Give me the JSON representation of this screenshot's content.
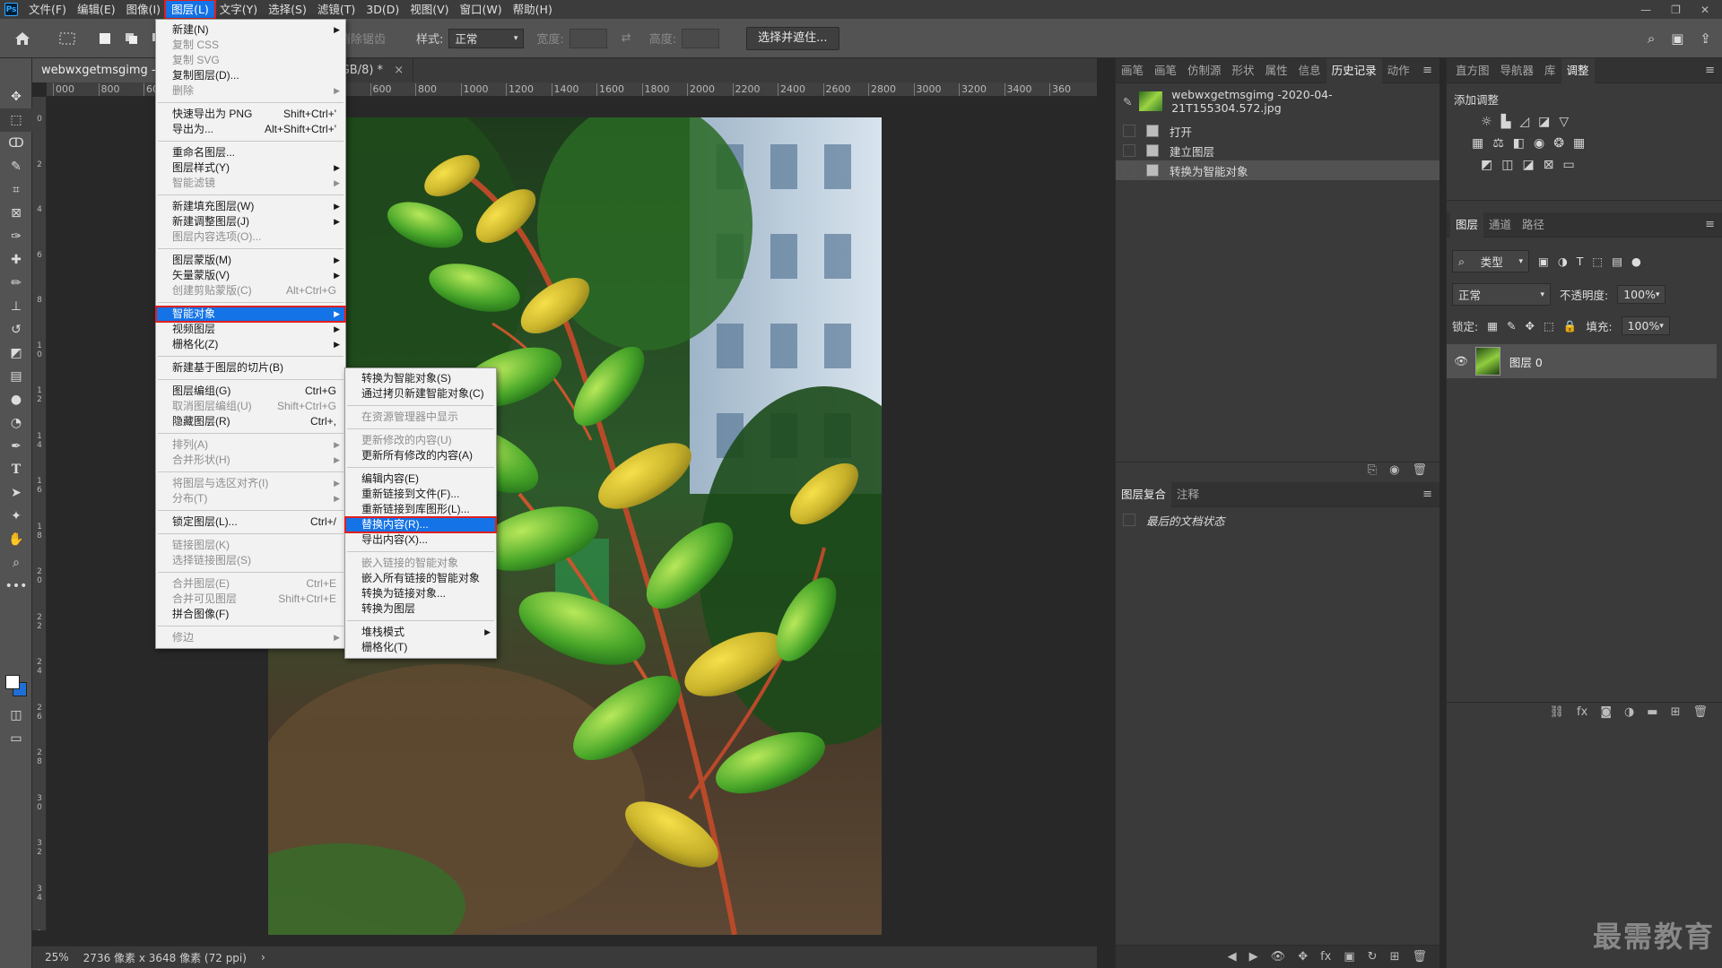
{
  "app": {
    "logo": "Ps"
  },
  "menubar": {
    "items": [
      "文件(F)",
      "编辑(E)",
      "图像(I)",
      "图层(L)",
      "文字(Y)",
      "选择(S)",
      "滤镜(T)",
      "3D(D)",
      "视图(V)",
      "窗口(W)",
      "帮助(H)"
    ],
    "active_index": 3
  },
  "options": {
    "style_label": "样式:",
    "style_value": "正常",
    "width_label": "宽度:",
    "height_label": "高度:",
    "feather_label": "消除锯齿",
    "select_mask_button": "选择并遮住..."
  },
  "document": {
    "tabs": [
      "webwxgetmsgimg - 2",
      "层 0, RGB/8) *"
    ],
    "ruler_top": [
      "000",
      "800",
      "600",
      "",
      "",
      "",
      "400",
      "600",
      "800",
      "1000",
      "1200",
      "1400",
      "1600",
      "1800",
      "2000",
      "2200",
      "2400",
      "2600",
      "2800",
      "3000",
      "3200",
      "3400",
      "360"
    ],
    "ruler_left": [
      "0",
      "2",
      "4",
      "6",
      "8",
      "1\n0",
      "1\n2",
      "1\n4",
      "1\n6",
      "1\n8",
      "2\n0",
      "2\n2",
      "2\n4",
      "2\n6",
      "2\n8",
      "3\n0",
      "3\n2",
      "3\n4",
      "3\n6"
    ],
    "zoom": "25%",
    "dimensions": "2736 像素 x 3648 像素 (72 ppi)"
  },
  "layer_menu": {
    "items": [
      {
        "label": "新建(N)",
        "arrow": true
      },
      {
        "label": "复制 CSS",
        "disabled": true
      },
      {
        "label": "复制 SVG",
        "disabled": true
      },
      {
        "label": "复制图层(D)..."
      },
      {
        "label": "删除",
        "disabled": true,
        "arrow": true
      },
      {
        "sep": true
      },
      {
        "label": "快速导出为 PNG",
        "shortcut": "Shift+Ctrl+'"
      },
      {
        "label": "导出为...",
        "shortcut": "Alt+Shift+Ctrl+'"
      },
      {
        "sep": true
      },
      {
        "label": "重命名图层..."
      },
      {
        "label": "图层样式(Y)",
        "arrow": true
      },
      {
        "label": "智能滤镜",
        "disabled": true,
        "arrow": true
      },
      {
        "sep": true
      },
      {
        "label": "新建填充图层(W)",
        "arrow": true
      },
      {
        "label": "新建调整图层(J)",
        "arrow": true
      },
      {
        "label": "图层内容选项(O)...",
        "disabled": true
      },
      {
        "sep": true
      },
      {
        "label": "图层蒙版(M)",
        "arrow": true
      },
      {
        "label": "矢量蒙版(V)",
        "arrow": true
      },
      {
        "label": "创建剪贴蒙版(C)",
        "shortcut": "Alt+Ctrl+G",
        "disabled": true
      },
      {
        "sep": true
      },
      {
        "label": "智能对象",
        "arrow": true,
        "highlight": true
      },
      {
        "label": "视频图层",
        "arrow": true
      },
      {
        "label": "栅格化(Z)",
        "arrow": true
      },
      {
        "sep": true
      },
      {
        "label": "新建基于图层的切片(B)"
      },
      {
        "sep": true
      },
      {
        "label": "图层编组(G)",
        "shortcut": "Ctrl+G"
      },
      {
        "label": "取消图层编组(U)",
        "shortcut": "Shift+Ctrl+G",
        "disabled": true
      },
      {
        "label": "隐藏图层(R)",
        "shortcut": "Ctrl+,"
      },
      {
        "sep": true
      },
      {
        "label": "排列(A)",
        "disabled": true,
        "arrow": true
      },
      {
        "label": "合并形状(H)",
        "disabled": true,
        "arrow": true
      },
      {
        "sep": true
      },
      {
        "label": "将图层与选区对齐(I)",
        "disabled": true,
        "arrow": true
      },
      {
        "label": "分布(T)",
        "disabled": true,
        "arrow": true
      },
      {
        "sep": true
      },
      {
        "label": "锁定图层(L)...",
        "shortcut": "Ctrl+/"
      },
      {
        "sep": true
      },
      {
        "label": "链接图层(K)",
        "disabled": true
      },
      {
        "label": "选择链接图层(S)",
        "disabled": true
      },
      {
        "sep": true
      },
      {
        "label": "合并图层(E)",
        "shortcut": "Ctrl+E",
        "disabled": true
      },
      {
        "label": "合并可见图层",
        "shortcut": "Shift+Ctrl+E",
        "disabled": true
      },
      {
        "label": "拼合图像(F)"
      },
      {
        "sep": true
      },
      {
        "label": "修边",
        "disabled": true,
        "arrow": true
      }
    ]
  },
  "smart_object_menu": {
    "items": [
      {
        "label": "转换为智能对象(S)"
      },
      {
        "label": "通过拷贝新建智能对象(C)"
      },
      {
        "sep": true
      },
      {
        "label": "在资源管理器中显示",
        "disabled": true
      },
      {
        "sep": true
      },
      {
        "label": "更新修改的内容(U)",
        "disabled": true
      },
      {
        "label": "更新所有修改的内容(A)"
      },
      {
        "sep": true
      },
      {
        "label": "编辑内容(E)"
      },
      {
        "label": "重新链接到文件(F)..."
      },
      {
        "label": "重新链接到库图形(L)..."
      },
      {
        "label": "替换内容(R)...",
        "highlight": true
      },
      {
        "label": "导出内容(X)..."
      },
      {
        "sep": true
      },
      {
        "label": "嵌入链接的智能对象",
        "disabled": true
      },
      {
        "label": "嵌入所有链接的智能对象"
      },
      {
        "label": "转换为链接对象..."
      },
      {
        "label": "转换为图层"
      },
      {
        "sep": true
      },
      {
        "label": "堆栈模式",
        "arrow": true
      },
      {
        "label": "栅格化(T)"
      }
    ]
  },
  "history_panel": {
    "tabs": [
      "画笔",
      "画笔",
      "仿制源",
      "形状",
      "属性",
      "信息",
      "历史记录",
      "动作"
    ],
    "active_tab": "历史记录",
    "snapshot": "webwxgetmsgimg -2020-04-21T155304.572.jpg",
    "steps": [
      "打开",
      "建立图层",
      "转换为智能对象"
    ]
  },
  "comps_panel": {
    "tabs": [
      "图层复合",
      "注释"
    ],
    "row": "最后的文档状态"
  },
  "adjust_panel": {
    "tabs": [
      "直方图",
      "导航器",
      "库",
      "调整"
    ],
    "active_tab": "调整",
    "title": "添加调整"
  },
  "layers_panel": {
    "tabs": [
      "图层",
      "通道",
      "路径"
    ],
    "filter_label": "类型",
    "blend_mode": "正常",
    "opacity_label": "不透明度:",
    "opacity_value": "100%",
    "lock_label": "锁定:",
    "fill_label": "填充:",
    "fill_value": "100%",
    "layer_name": "图层 0"
  },
  "watermark": "最需教育"
}
